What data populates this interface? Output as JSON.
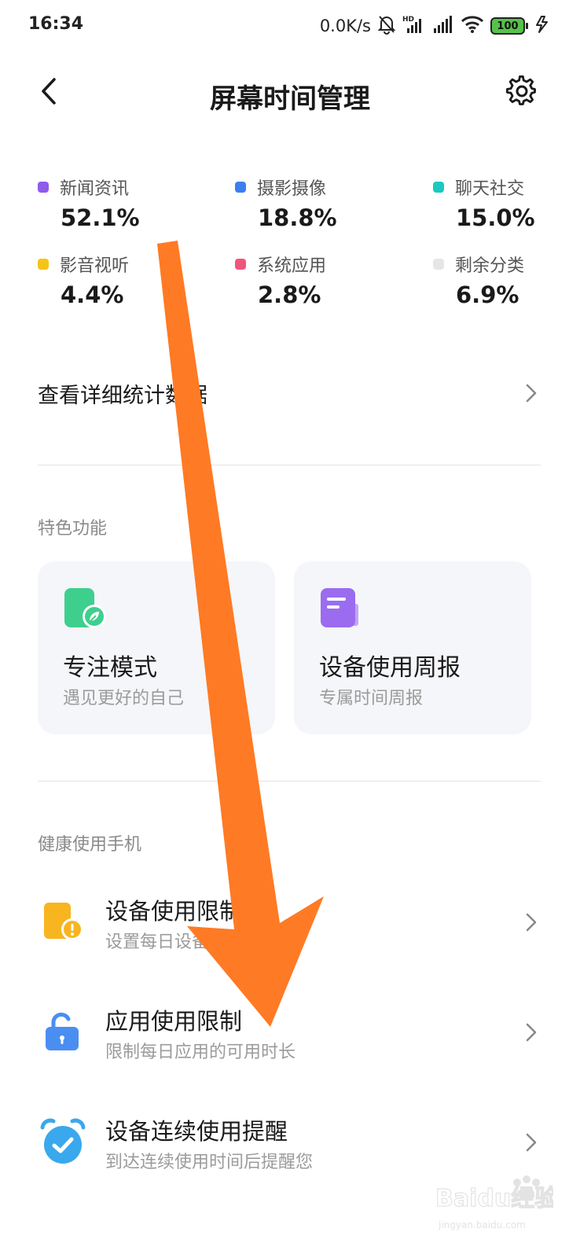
{
  "status_bar": {
    "time": "16:34",
    "net_speed": "0.0K/s",
    "battery": "100",
    "icons": [
      "mute-bell-icon",
      "hd-signal-icon",
      "signal-icon",
      "wifi-icon",
      "battery-icon",
      "charging-icon"
    ]
  },
  "header": {
    "title": "屏幕时间管理",
    "back_icon": "chevron-left-icon",
    "settings_icon": "gear-icon"
  },
  "categories": [
    {
      "label": "新闻资讯",
      "value": "52.1%",
      "color": "#8e5bea"
    },
    {
      "label": "摄影摄像",
      "value": "18.8%",
      "color": "#3d7ef0"
    },
    {
      "label": "聊天社交",
      "value": "15.0%",
      "color": "#1cc9c0"
    },
    {
      "label": "影音视听",
      "value": "4.4%",
      "color": "#f4c418"
    },
    {
      "label": "系统应用",
      "value": "2.8%",
      "color": "#f0557e"
    },
    {
      "label": "剩余分类",
      "value": "6.9%",
      "color": "#e6e6e6"
    }
  ],
  "detail_link": {
    "label": "查看详细统计数据"
  },
  "features": {
    "title": "特色功能",
    "cards": [
      {
        "title": "专注模式",
        "subtitle": "遇见更好的自己",
        "icon": "leaf-phone-icon",
        "color": "#3ecf8e"
      },
      {
        "title": "设备使用周报",
        "subtitle": "专属时间周报",
        "icon": "report-icon",
        "color": "#9b6cf0"
      }
    ]
  },
  "health": {
    "title": "健康使用手机",
    "items": [
      {
        "title": "设备使用限制",
        "subtitle": "设置每日设备可用时长",
        "icon": "device-limit-icon",
        "color": "#f8b520"
      },
      {
        "title": "应用使用限制",
        "subtitle": "限制每日应用的可用时长",
        "icon": "unlock-icon",
        "color": "#4a8ef2"
      },
      {
        "title": "设备连续使用提醒",
        "subtitle": "到达连续使用时间后提醒您",
        "icon": "alarm-clock-icon",
        "color": "#3aa8ec"
      }
    ]
  },
  "annotation": {
    "color": "#ff7a24",
    "icon": "orange-arrow-annotation"
  },
  "watermark": {
    "text": "Baidu经验",
    "sub": "jingyan.baidu.com"
  }
}
